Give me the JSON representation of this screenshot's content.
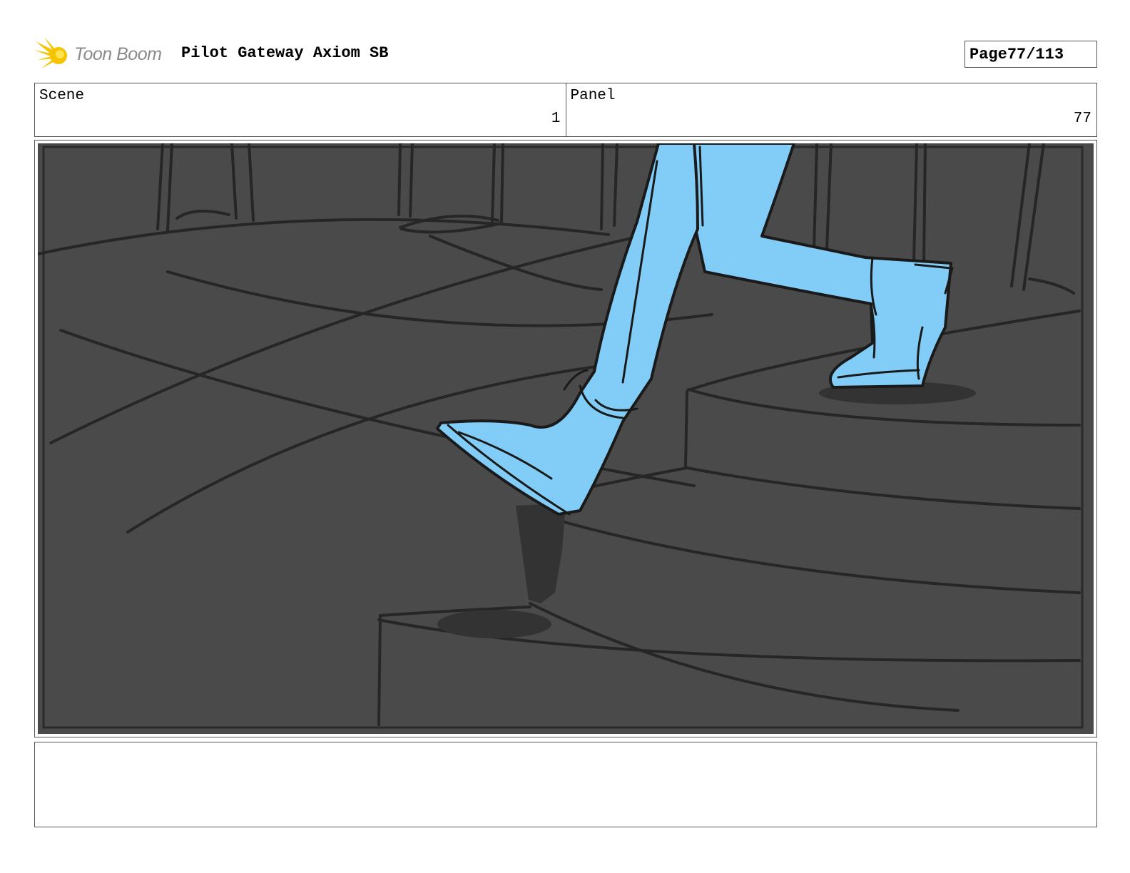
{
  "header": {
    "logo_text": "Toon Boom",
    "project_title": "Pilot Gateway Axiom SB",
    "page_label": "Page",
    "page_number": "77/113"
  },
  "info": {
    "scene_label": "Scene",
    "scene_value": "1",
    "panel_label": "Panel",
    "panel_value": "77"
  },
  "panel": {
    "background_color": "#4a4a4a",
    "character_color": "#82cdf7",
    "line_color": "#1a1a1a",
    "shadow_color": "#333333"
  },
  "notes": {
    "text": ""
  }
}
